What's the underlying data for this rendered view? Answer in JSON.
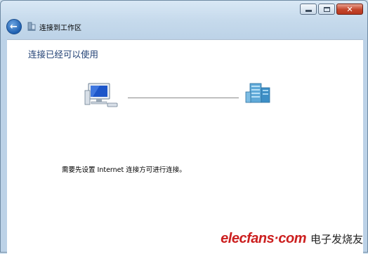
{
  "window": {
    "caption": {
      "minimize_icon": "minimize-icon",
      "maximize_icon": "maximize-icon",
      "close_icon": "close-icon"
    }
  },
  "nav": {
    "back_icon": "back-arrow-icon",
    "title": "连接到工作区"
  },
  "main": {
    "heading": "连接已经可以使用",
    "message": "需要先设置 Internet 连接方可进行连接。"
  },
  "watermark": {
    "site": "elecfans·com",
    "cn": "电子发烧友"
  },
  "colors": {
    "heading": "#1f3f73",
    "accent": "#1e5fb0",
    "watermark": "#cc1f1f"
  }
}
